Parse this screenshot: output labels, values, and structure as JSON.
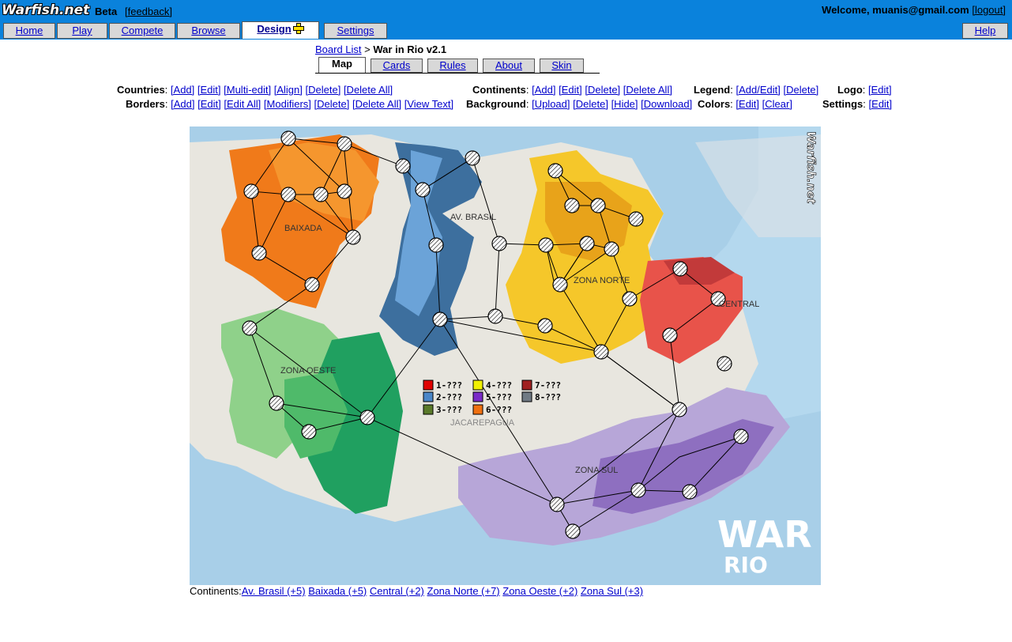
{
  "header": {
    "logo": "Warfish.net",
    "beta": "Beta",
    "feedback": "[feedback]",
    "welcome": "Welcome, muanis@gmail.com",
    "logout": "[logout]"
  },
  "nav": {
    "home": "Home",
    "play": "Play",
    "compete": "Compete",
    "browse": "Browse",
    "design": "Design",
    "settings": "Settings",
    "help": "Help"
  },
  "breadcrumb": {
    "board_list": "Board List",
    "sep": ">",
    "current": "War in Rio v2.1"
  },
  "subtabs": {
    "map": "Map",
    "cards": "Cards",
    "rules": "Rules",
    "about": "About",
    "skin": "Skin"
  },
  "tools": {
    "countries": {
      "label": "Countries",
      "links": [
        "[Add]",
        "[Edit]",
        "[Multi-edit]",
        "[Align]",
        "[Delete]",
        "[Delete All]"
      ]
    },
    "borders": {
      "label": "Borders",
      "links": [
        "[Add]",
        "[Edit]",
        "[Edit All]",
        "[Modifiers]",
        "[Delete]",
        "[Delete All]",
        "[View Text]"
      ]
    },
    "continents": {
      "label": "Continents",
      "links": [
        "[Add]",
        "[Edit]",
        "[Delete]",
        "[Delete All]"
      ]
    },
    "background": {
      "label": "Background",
      "links": [
        "[Upload]",
        "[Delete]",
        "[Hide]",
        "[Download]"
      ]
    },
    "legend": {
      "label": "Legend",
      "links": [
        "[Add/Edit]",
        "[Delete]"
      ]
    },
    "colors": {
      "label": "Colors",
      "links": [
        "[Edit]",
        "[Clear]"
      ]
    },
    "logo": {
      "label": "Logo",
      "links": [
        "[Edit]"
      ]
    },
    "settings": {
      "label": "Settings",
      "links": [
        "[Edit]"
      ]
    }
  },
  "map": {
    "labels": {
      "baixada": "BAIXADA",
      "av_brasil": "AV. BRASIL",
      "zona_norte": "ZONA NORTE",
      "central": "CENTRAL",
      "zona_oeste": "ZONA OESTE",
      "zona_sul": "ZONA SUL",
      "jacarepagua": "JACAREPAGUA",
      "war": "WAR",
      "rio": "RIO",
      "warfish": "Warfish.net"
    },
    "legend": [
      {
        "text": "1-???",
        "color": "#e00000"
      },
      {
        "text": "2-???",
        "color": "#4a86c8"
      },
      {
        "text": "3-???",
        "color": "#5a7a2a"
      },
      {
        "text": "4-???",
        "color": "#f0f000"
      },
      {
        "text": "5-???",
        "color": "#7a2ac8"
      },
      {
        "text": "6-???",
        "color": "#f07010"
      },
      {
        "text": "7-???",
        "color": "#a02020"
      },
      {
        "text": "8-???",
        "color": "#707a84"
      }
    ]
  },
  "footer": {
    "label": "Continents:",
    "continents": [
      "Av. Brasil (+5)",
      "Baixada (+5)",
      "Central (+2)",
      "Zona Norte (+7)",
      "Zona Oeste (+2)",
      "Zona Sul (+3)"
    ]
  }
}
